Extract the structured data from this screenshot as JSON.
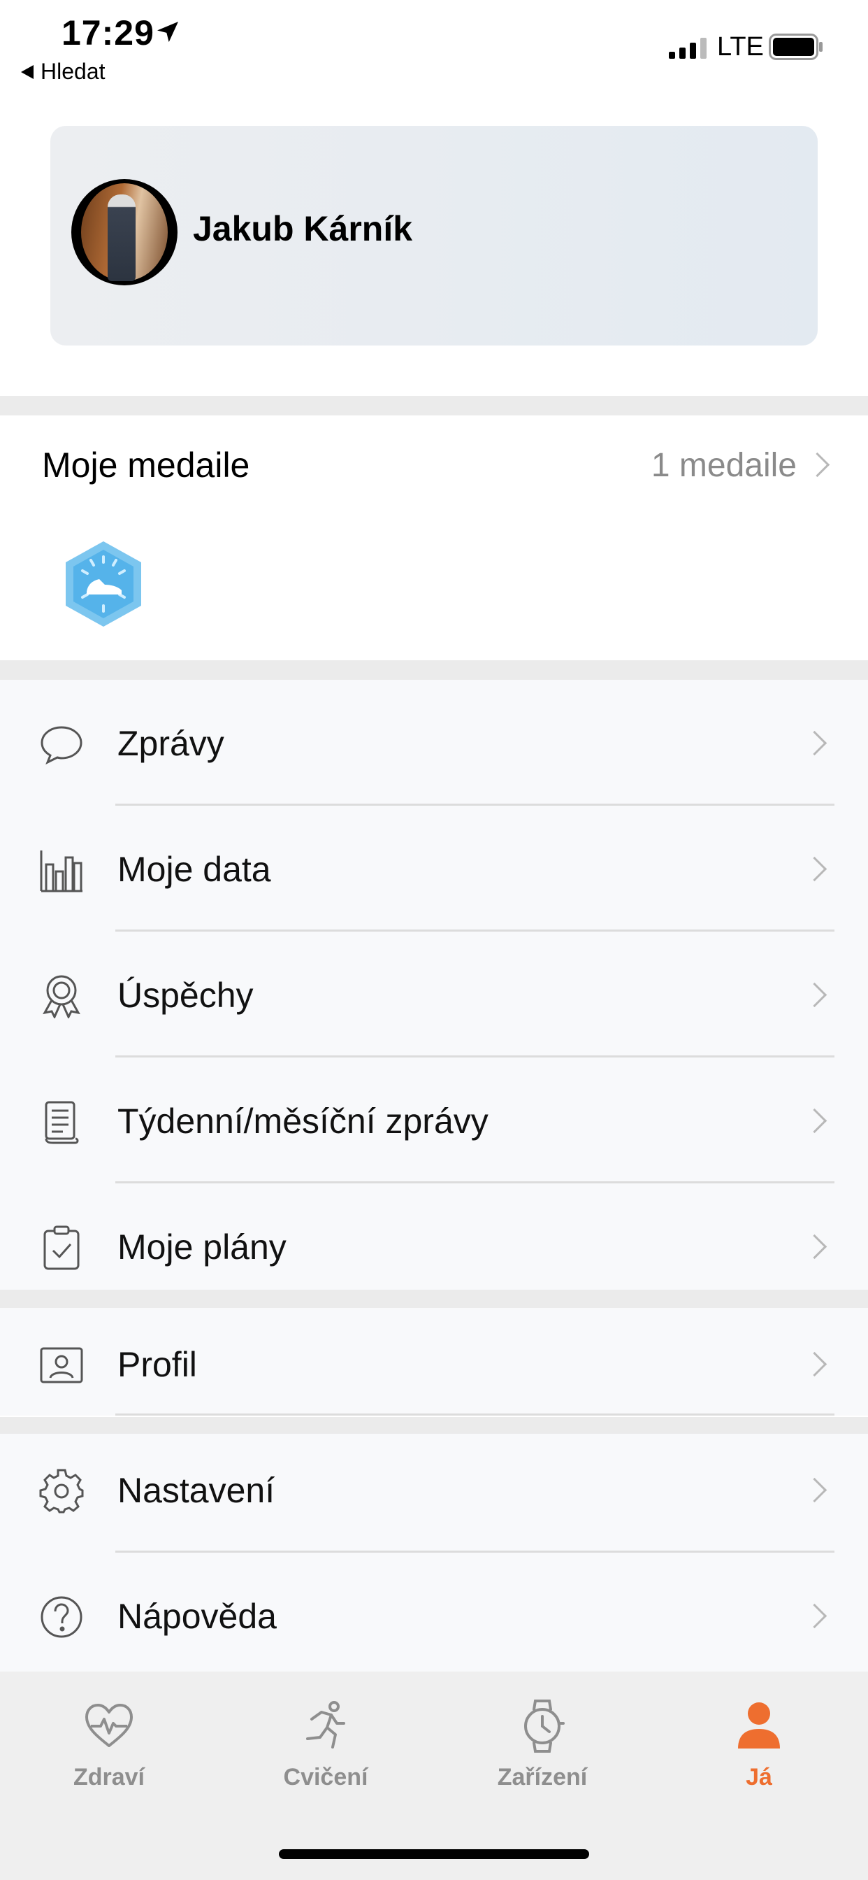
{
  "status_bar": {
    "time": "17:29",
    "back_label": "Hledat",
    "network": "LTE"
  },
  "profile": {
    "name": "Jakub Kárník"
  },
  "medals": {
    "title": "Moje medaile",
    "count_label": "1 medaile"
  },
  "menu": {
    "group1": [
      {
        "label": "Zprávy",
        "icon": "chat-bubble-icon"
      },
      {
        "label": "Moje data",
        "icon": "bar-chart-icon"
      },
      {
        "label": "Úspěchy",
        "icon": "award-icon"
      },
      {
        "label": "Týdenní/měsíční zprávy",
        "icon": "report-scroll-icon"
      },
      {
        "label": "Moje plány",
        "icon": "clipboard-check-icon"
      }
    ],
    "group2": [
      {
        "label": "Profil",
        "icon": "profile-card-icon"
      }
    ],
    "group3": [
      {
        "label": "Nastavení",
        "icon": "gear-icon"
      },
      {
        "label": "Nápověda",
        "icon": "help-icon"
      }
    ]
  },
  "tabs": [
    {
      "label": "Zdraví",
      "icon": "heart-pulse-icon"
    },
    {
      "label": "Cvičení",
      "icon": "running-icon"
    },
    {
      "label": "Zařízení",
      "icon": "watch-icon"
    },
    {
      "label": "Já",
      "icon": "person-icon"
    }
  ],
  "colors": {
    "accent": "#ee6e2f",
    "inactive_tab": "#8e8e8e",
    "medal": "#7cc6ef"
  }
}
